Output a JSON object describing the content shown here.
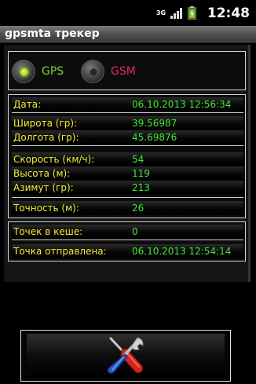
{
  "status_bar": {
    "network": "3G",
    "clock": "12:48",
    "icons": [
      "network-3g-icon",
      "signal-icon",
      "battery-icon"
    ]
  },
  "app_title": "gpsmta трекер",
  "mode": {
    "options": [
      {
        "label": "GPS",
        "selected": true
      },
      {
        "label": "GSM",
        "selected": false
      }
    ]
  },
  "fields": {
    "date": {
      "label": "Дата:",
      "value": "06.10.2013 12:56:34"
    },
    "latitude": {
      "label": "Широта (гр):",
      "value": "39.56987"
    },
    "longitude": {
      "label": "Долгота (гр):",
      "value": "45.69876"
    },
    "speed": {
      "label": "Скорость (км/ч):",
      "value": "54"
    },
    "altitude": {
      "label": "Высота (м):",
      "value": "119"
    },
    "azimuth": {
      "label": "Азимут (гр):",
      "value": "213"
    },
    "accuracy": {
      "label": "Точность (м):",
      "value": "26"
    }
  },
  "cache": {
    "points_cached": {
      "label": "Точек в кеше:",
      "value": "0"
    },
    "point_sent": {
      "label": "Точка отправлена:",
      "value": "06.10.2013 12:54:14"
    }
  },
  "tools_button": {
    "icon": "tools-icon"
  },
  "colors": {
    "label": "#f2ee32",
    "value": "#42e636",
    "gps": "#7ad53c",
    "gsm": "#e8236c"
  }
}
